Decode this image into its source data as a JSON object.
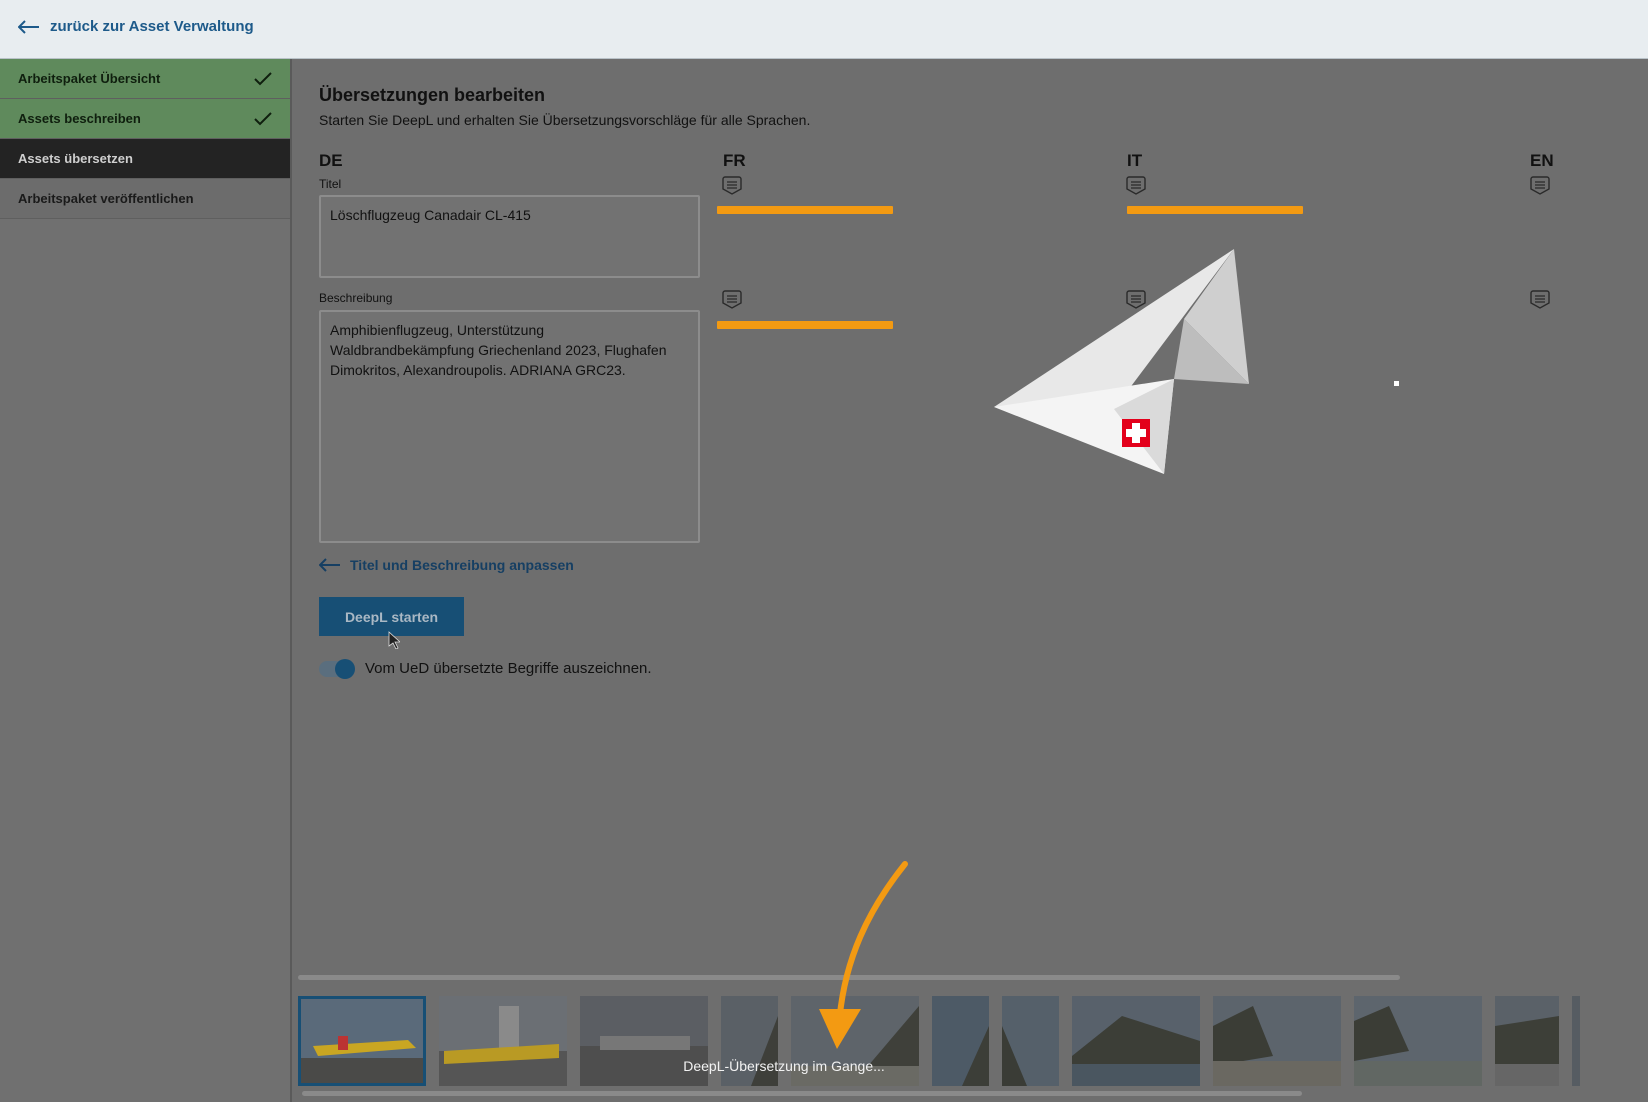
{
  "topbar": {
    "back_label": "zurück zur Asset Verwaltung"
  },
  "sidebar": {
    "steps": [
      {
        "label": "Arbeitspaket Übersicht",
        "state": "done"
      },
      {
        "label": "Assets beschreiben",
        "state": "done"
      },
      {
        "label": "Assets übersetzen",
        "state": "active"
      },
      {
        "label": "Arbeitspaket veröffentlichen",
        "state": "todo"
      }
    ]
  },
  "main": {
    "heading": "Übersetzungen bearbeiten",
    "subheading": "Starten Sie DeepL und erhalten Sie Übersetzungsvorschläge für alle Sprachen.",
    "languages": [
      "DE",
      "FR",
      "IT",
      "EN"
    ],
    "title_label": "Titel",
    "title_value": "Löschflugzeug Canadair CL-415",
    "description_label": "Beschreibung",
    "description_value": "Amphibienflugzeug, Unterstützung Waldbrandbekämpfung Griechenland 2023, Flughafen Dimokritos, Alexandroupolis. ADRIANA GRC23.",
    "adjust_link": "Titel und Beschreibung anpassen",
    "deepl_button": "DeepL starten",
    "toggle_label": "Vom UeD übersetzte Begriffe auszeichnen.",
    "toggle_on": true
  },
  "filmstrip": {
    "status": "DeepL-Übersetzung im Gange...",
    "thumbnail_count": 12,
    "selected_index": 0
  },
  "colors": {
    "accent": "#174f75",
    "progress": "#f39a12",
    "done_step": "#5f8a5c",
    "active_step": "#232323"
  }
}
